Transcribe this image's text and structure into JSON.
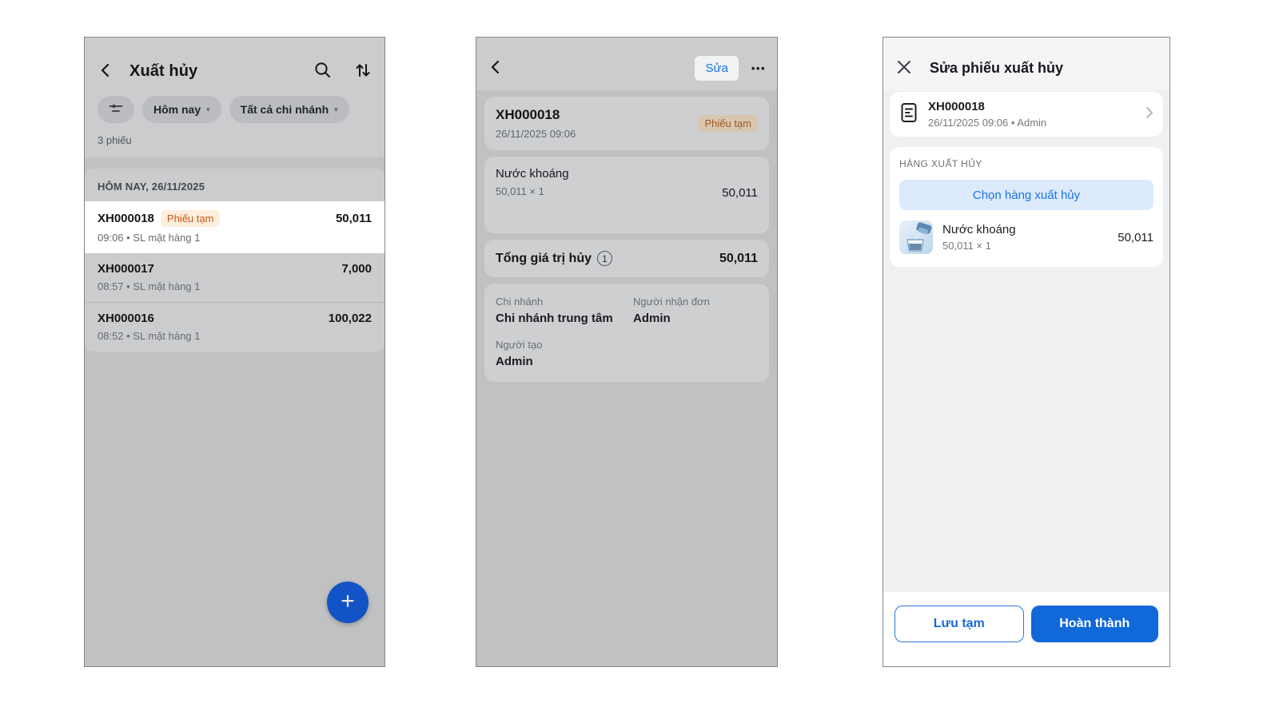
{
  "colors": {
    "accent_blue": "#1a73e8",
    "primary_button_blue": "#1168d8",
    "fab_blue": "#1254c5",
    "badge_bg": "#fdeede",
    "badge_text": "#c05a17",
    "select_button_bg": "#dceafc"
  },
  "icons": {
    "caret": "▾",
    "plus": "+",
    "more": "•••"
  },
  "screen1": {
    "title": "Xuất hủy",
    "chips": {
      "period": "Hôm nay",
      "branch": "Tất cả chi nhánh"
    },
    "count": "3 phiếu",
    "section": "HÔM NAY, 26/11/2025",
    "rows": [
      {
        "code": "XH000018",
        "badge": "Phiếu tạm",
        "amount": "50,011",
        "meta": "09:06 • SL mặt hàng 1"
      },
      {
        "code": "XH000017",
        "amount": "7,000",
        "meta": "08:57 • SL mặt hàng 1"
      },
      {
        "code": "XH000016",
        "amount": "100,022",
        "meta": "08:52 • SL mặt hàng 1"
      }
    ]
  },
  "screen2": {
    "edit_label": "Sửa",
    "code": "XH000018",
    "datetime": "26/11/2025 09:06",
    "badge": "Phiếu tạm",
    "product": {
      "name": "Nước khoáng",
      "qty": "50,011 × 1",
      "amount": "50,011"
    },
    "total": {
      "label": "Tổng giá trị hủy",
      "count": "1",
      "amount": "50,011"
    },
    "info": [
      {
        "label": "Chi nhánh",
        "value": "Chi nhánh trung tâm"
      },
      {
        "label": "Người nhận đơn",
        "value": "Admin"
      },
      {
        "label": "Người tạo",
        "value": "Admin"
      }
    ]
  },
  "screen3": {
    "title": "Sửa phiếu xuất hủy",
    "doc": {
      "code": "XH000018",
      "meta": "26/11/2025 09:06 • Admin"
    },
    "section": "HÀNG XUẤT HỦY",
    "select_button": "Chọn hàng xuất hủy",
    "product": {
      "name": "Nước khoáng",
      "qty": "50,011 × 1",
      "amount": "50,011"
    },
    "footer": {
      "draft": "Lưu tạm",
      "complete": "Hoàn thành"
    }
  }
}
